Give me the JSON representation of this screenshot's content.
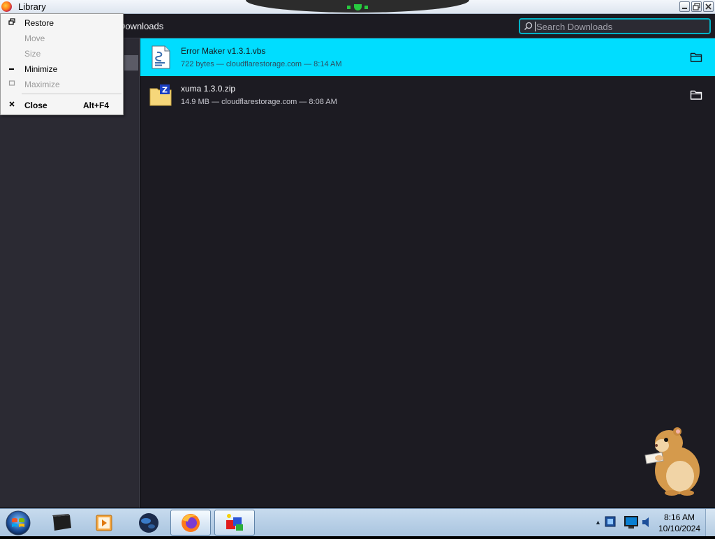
{
  "window": {
    "title": "Library"
  },
  "toolbar": {
    "clear_label": "r Downloads",
    "search_placeholder": "Search Downloads"
  },
  "downloads": [
    {
      "name": "Error Maker v1.3.1.vbs",
      "meta": "722 bytes — cloudflarestorage.com — 8:14 AM",
      "selected": true,
      "icon": "script-file-icon"
    },
    {
      "name": "xuma 1.3.0.zip",
      "meta": "14.9 MB — cloudflarestorage.com — 8:08 AM",
      "selected": false,
      "icon": "zip-archive-icon"
    }
  ],
  "system_menu": {
    "items": [
      {
        "label": "Restore",
        "glyph": "restore-icon",
        "enabled": true
      },
      {
        "label": "Move",
        "glyph": "",
        "enabled": false
      },
      {
        "label": "Size",
        "glyph": "",
        "enabled": false
      },
      {
        "label": "Minimize",
        "glyph": "minimize-icon",
        "enabled": true
      },
      {
        "label": "Maximize",
        "glyph": "maximize-icon",
        "enabled": false
      },
      {
        "label": "Close",
        "glyph": "close-icon",
        "enabled": true,
        "shortcut": "Alt+F4"
      }
    ]
  },
  "taskbar": {
    "clock_time": "8:16 AM",
    "clock_date": "10/10/2024",
    "apps": [
      "terminal-icon",
      "media-player-icon",
      "globe-icon",
      "firefox-icon",
      "3d-blocks-icon"
    ]
  },
  "colors": {
    "accent": "#00ddff",
    "search_border": "#00b3c7",
    "background": "#1c1b22",
    "sidebar": "#2b2a33"
  }
}
